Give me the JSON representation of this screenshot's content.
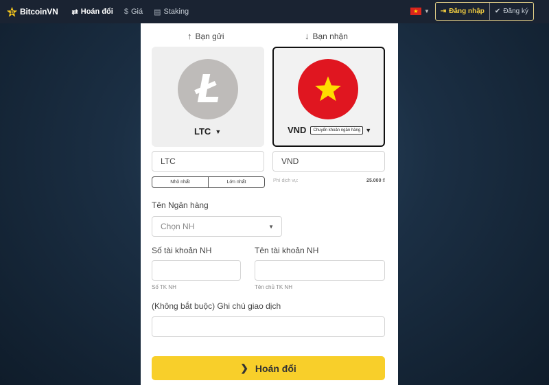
{
  "nav": {
    "logo_text": "BitcoinVN",
    "items": [
      {
        "label": "Hoán đổi",
        "icon": "swap-icon"
      },
      {
        "label": "Giá",
        "icon": "dollar-icon"
      },
      {
        "label": "Staking",
        "icon": "stack-icon"
      }
    ],
    "login_label": "Đăng nhập",
    "register_label": "Đăng ký"
  },
  "swap": {
    "send_label": "Bạn gửi",
    "receive_label": "Bạn nhận",
    "send_currency": "LTC",
    "receive_currency": "VND",
    "receive_method": "Chuyển khoản ngân hàng",
    "send_amount_placeholder": "LTC",
    "receive_amount_placeholder": "VND",
    "min_label": "Nhỏ nhất",
    "max_label": "Lớn nhất",
    "fee_label": "Phí dịch vụ:",
    "fee_value": "25.000 ₫"
  },
  "bank": {
    "bank_name_label": "Tên Ngân hàng",
    "bank_select_placeholder": "Chọn NH",
    "account_number_label": "Số tài khoản NH",
    "account_name_label": "Tên tài khoản NH",
    "account_number_hint": "Số TK NH",
    "account_name_hint": "Tên chủ TK NH",
    "note_label": "(Không bắt buộc) Ghi chú giao dịch"
  },
  "submit_label": "Hoán đổi",
  "colors": {
    "accent": "#f8cf2a",
    "navbar": "#1a2332",
    "vn_red": "#e01620",
    "vn_star": "#ffde00"
  }
}
